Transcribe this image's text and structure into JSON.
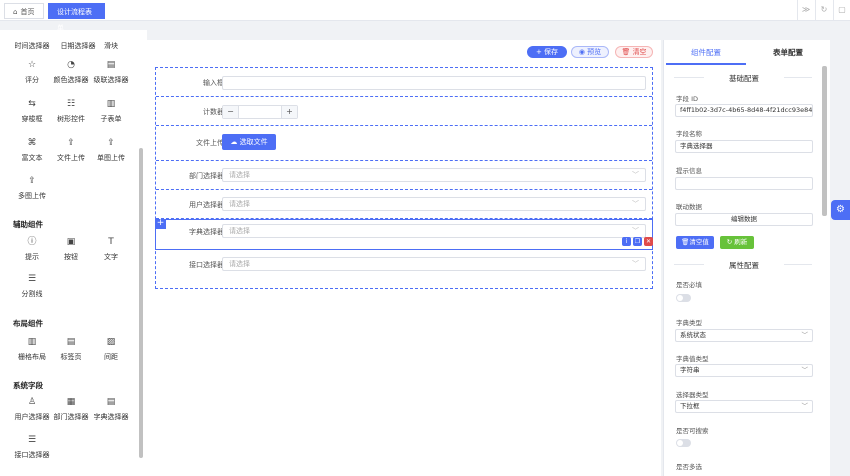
{
  "tabs": [
    {
      "label": "首页",
      "icon": "home-icon",
      "active": false
    },
    {
      "label": "设计流程表单",
      "active": true
    }
  ],
  "palette": {
    "basic_items": [
      {
        "label": "时间选择器",
        "icon": ""
      },
      {
        "label": "日期选择器",
        "icon": ""
      },
      {
        "label": "滑块",
        "icon": ""
      },
      {
        "label": "评分",
        "icon": "star-icon",
        "glyph": "☆"
      },
      {
        "label": "颜色选择器",
        "icon": "palette-icon",
        "glyph": "◔"
      },
      {
        "label": "级联选择器",
        "icon": "cascader-icon",
        "glyph": "▤"
      },
      {
        "label": "穿梭框",
        "icon": "transfer-icon",
        "glyph": "⇆"
      },
      {
        "label": "树形控件",
        "icon": "tree-icon",
        "glyph": "☷"
      },
      {
        "label": "子表单",
        "icon": "subform-icon",
        "glyph": "▥"
      },
      {
        "label": "富文本",
        "icon": "richtext-icon",
        "glyph": "⌘"
      },
      {
        "label": "文件上传",
        "icon": "upload-icon",
        "glyph": "⇪"
      },
      {
        "label": "单图上传",
        "icon": "image-upload-icon",
        "glyph": "⇪"
      },
      {
        "label": "多图上传",
        "icon": "multi-image-upload-icon",
        "glyph": "⇪"
      }
    ],
    "aux_title": "辅助组件",
    "aux_items": [
      {
        "label": "提示",
        "icon": "info-icon",
        "glyph": "ⓘ"
      },
      {
        "label": "按钮",
        "icon": "button-icon",
        "glyph": "▣"
      },
      {
        "label": "文字",
        "icon": "text-icon",
        "glyph": "T"
      },
      {
        "label": "分割线",
        "icon": "divider-icon",
        "glyph": "☰"
      }
    ],
    "layout_title": "布局组件",
    "layout_items": [
      {
        "label": "栅格布局",
        "icon": "grid-icon",
        "glyph": "▥"
      },
      {
        "label": "标签页",
        "icon": "tabs-icon",
        "glyph": "▤"
      },
      {
        "label": "间距",
        "icon": "spacing-icon",
        "glyph": "▨"
      }
    ],
    "system_title": "系统字段",
    "system_items": [
      {
        "label": "用户选择器",
        "icon": "user-icon",
        "glyph": "♙"
      },
      {
        "label": "部门选择器",
        "icon": "dept-icon",
        "glyph": "▦"
      },
      {
        "label": "字典选择器",
        "icon": "dict-icon",
        "glyph": "▤"
      },
      {
        "label": "接口选择器",
        "icon": "api-icon",
        "glyph": "☰"
      }
    ]
  },
  "toolbar": {
    "save_label": "保存",
    "preview_label": "预览",
    "clear_label": "清空"
  },
  "form_rows": [
    {
      "label": "输入框",
      "type": "input",
      "placeholder": ""
    },
    {
      "label": "计数器",
      "type": "stepper",
      "minus": "−",
      "plus": "+"
    },
    {
      "label": "文件上传",
      "type": "upload",
      "button": "选取文件"
    },
    {
      "label": "部门选择器",
      "type": "select",
      "placeholder": "请选择"
    },
    {
      "label": "用户选择器",
      "type": "select",
      "placeholder": "请选择"
    },
    {
      "label": "字典选择器",
      "type": "select",
      "placeholder": "请选择",
      "selected": true
    },
    {
      "label": "接口选择器",
      "type": "select",
      "placeholder": "请选择"
    }
  ],
  "right_panel": {
    "tab_component": "组件配置",
    "tab_form": "表单配置",
    "basic_section": "基础配置",
    "field_id_label": "字段 ID",
    "field_id_value": "f4ff1b02-3d7c-4b65-8d48-4f21dcc93e84",
    "field_name_label": "字段名称",
    "field_name_value": "字典选择器",
    "hint_label": "提示信息",
    "hint_value": "",
    "linkage_label": "联动数据",
    "edit_data_button": "编辑数据",
    "clear_value_button": "清空值",
    "refresh_button": "刷新",
    "attr_section": "属性配置",
    "required_label": "是否必填",
    "dict_type_label": "字典类型",
    "dict_type_value": "系统状态",
    "dict_value_type_label": "字典值类型",
    "dict_value_type_value": "字符串",
    "selector_type_label": "选择器类型",
    "selector_type_value": "下拉框",
    "searchable_label": "是否可搜索",
    "multiple_label": "是否多选"
  },
  "colors": {
    "primary": "#4d6ef5",
    "danger": "#e04b4b",
    "success": "#67c23a"
  }
}
